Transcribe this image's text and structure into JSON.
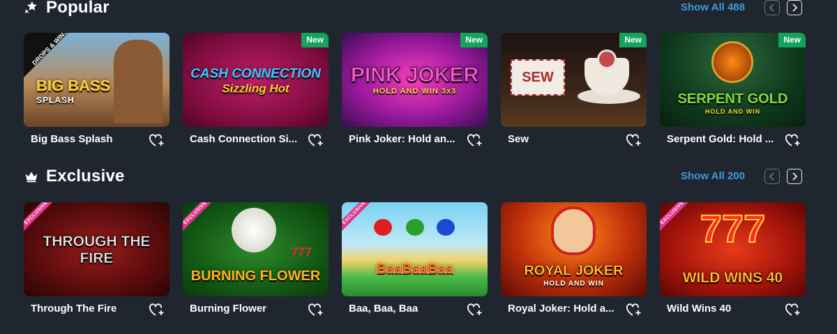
{
  "sections": [
    {
      "title": "Popular",
      "icon": "star-badge-icon",
      "show_all": "Show All 488",
      "games": [
        {
          "name": "Big Bass Splash",
          "art_title": "BIG BASS",
          "art_sub": "SPLASH",
          "art_corner": "DROPS & WINS",
          "badge": ""
        },
        {
          "name": "Cash Connection Si...",
          "art_title": "CASH CONNECTION",
          "art_sub": "Sizzling Hot",
          "badge": "New"
        },
        {
          "name": "Pink Joker: Hold an...",
          "art_title": "PINK JOKER",
          "art_sub": "HOLD AND WIN 3x3",
          "badge": "New"
        },
        {
          "name": "Sew",
          "art_title": "SEW",
          "art_sub": "",
          "badge": "New"
        },
        {
          "name": "Serpent Gold: Hold ...",
          "art_title": "SERPENT GOLD",
          "art_sub": "HOLD AND WIN",
          "badge": "New"
        }
      ]
    },
    {
      "title": "Exclusive",
      "icon": "crown-icon",
      "show_all": "Show All 200",
      "games": [
        {
          "name": "Through The Fire",
          "art_title": "THROUGH THE FIRE",
          "art_sub": "",
          "ribbon": "EXCLUSIVE"
        },
        {
          "name": "Burning Flower",
          "art_title": "BURNING FLOWER",
          "art_sub": "777",
          "ribbon": "EXCLUSIVE"
        },
        {
          "name": "Baa, Baa, Baa",
          "art_title": "BaaBaaBaa",
          "art_sub": "",
          "ribbon": "EXCLUSIVE"
        },
        {
          "name": "Royal Joker: Hold a...",
          "art_title": "ROYAL JOKER",
          "art_sub": "HOLD AND WIN",
          "ribbon": ""
        },
        {
          "name": "Wild Wins 40",
          "art_title": "WILD WINS 40",
          "art_sub": "777",
          "ribbon": "EXCLUSIVE"
        }
      ]
    }
  ],
  "colors": {
    "background": "#1f2630",
    "link": "#3d9bd9",
    "new_badge": "#14a35a",
    "exclusive_ribbon": "#e0338a"
  }
}
